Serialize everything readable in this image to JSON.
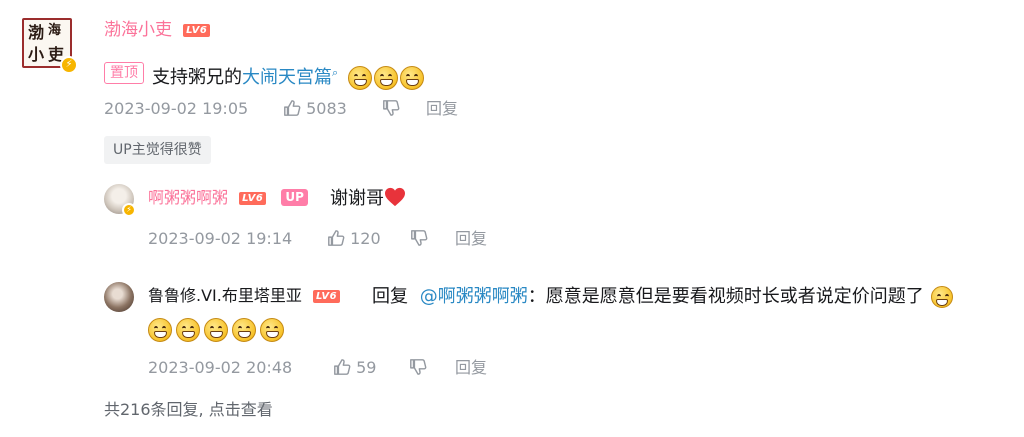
{
  "comment": {
    "avatar_chars": [
      "渤",
      "海",
      "小",
      "吏"
    ],
    "username": "渤海小吏",
    "level": "LV6",
    "pinned_label": "置顶",
    "text_prefix": "支持粥兄的",
    "link_text": "大闹天宫篇",
    "emoji_count": 3,
    "date": "2023-09-02 19:05",
    "likes": "5083",
    "reply_label": "回复",
    "up_liked_tag": "UP主觉得很赞"
  },
  "replies": [
    {
      "username": "啊粥粥啊粥",
      "level": "LV6",
      "up_badge": "UP",
      "text": "谢谢哥",
      "date": "2023-09-02 19:14",
      "likes": "120",
      "reply_label": "回复"
    },
    {
      "username": "鲁鲁修.VI.布里塔里亚",
      "level": "LV6",
      "reply_prefix": "回复",
      "mention": "@啊粥粥啊粥",
      "text": "：愿意是愿意但是要看视频时长或者说定价问题了",
      "date": "2023-09-02 20:48",
      "likes": "59",
      "reply_label": "回复"
    }
  ],
  "footer": {
    "more_replies": "共216条回复, 点击查看"
  },
  "colors": {
    "username_pink": "#fb7299",
    "link_blue": "#2a89c4",
    "meta_gray": "#9499a0",
    "level_red": "#ff6b5b",
    "heart_red": "#e8333b"
  },
  "icons": [
    "thumbs-up-icon",
    "thumbs-down-icon",
    "search-icon",
    "grin-emoji",
    "heart-icon",
    "vip-badge-icon"
  ]
}
